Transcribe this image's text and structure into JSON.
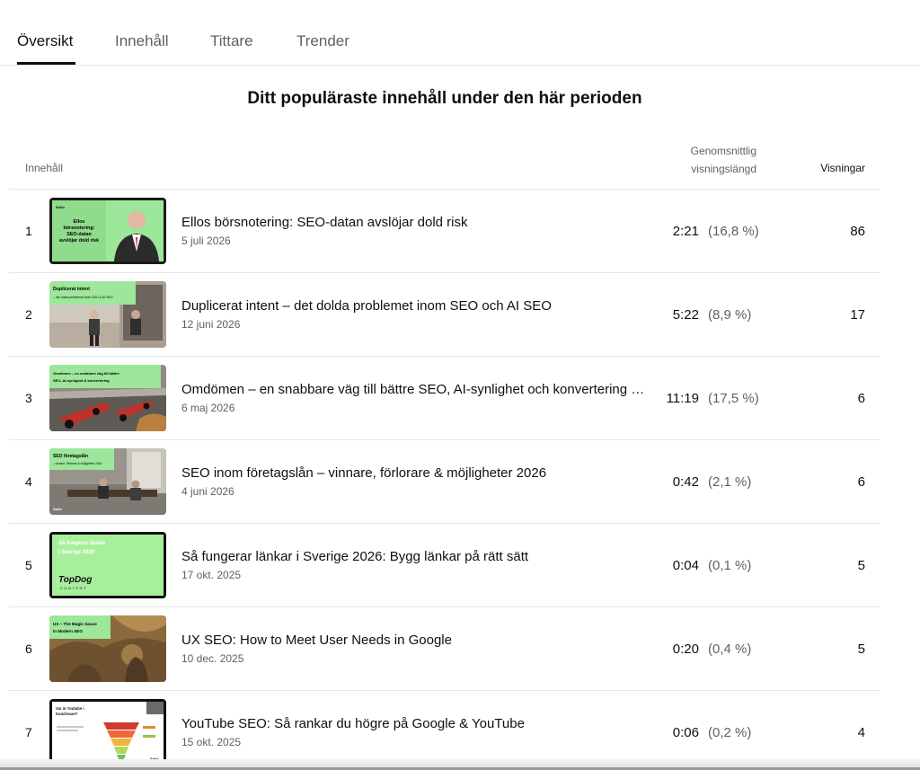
{
  "tabs": [
    {
      "label": "Översikt",
      "active": true
    },
    {
      "label": "Innehåll",
      "active": false
    },
    {
      "label": "Tittare",
      "active": false
    },
    {
      "label": "Trender",
      "active": false
    }
  ],
  "section": {
    "title": "Ditt populäraste innehåll under den här perioden"
  },
  "table": {
    "headers": {
      "content": "Innehåll",
      "avg_line1": "Genomsnittlig",
      "avg_line2": "visningslängd",
      "views": "Visningar"
    },
    "rows": [
      {
        "rank": "1",
        "title": "Ellos börsnotering: SEO-datan avslöjar dold risk",
        "date": "5 juli 2026",
        "duration": "2:21",
        "percent": "(16,8 %)",
        "views": "86",
        "thumb_text": [
          "Ellos",
          "börsnotering:",
          "SEO-datan",
          "avslöjar dold risk"
        ]
      },
      {
        "rank": "2",
        "title": "Duplicerat intent – det dolda problemet inom SEO och AI SEO",
        "date": "12 juni 2026",
        "duration": "5:22",
        "percent": "(8,9 %)",
        "views": "17",
        "thumb_text": [
          "Duplicerat intent",
          "– det dolda problemet inom SEO & AI SEO"
        ]
      },
      {
        "rank": "3",
        "title": "Omdömen – en snabbare väg till bättre SEO, AI-synlighet och konvertering …",
        "date": "6 maj 2026",
        "duration": "11:19",
        "percent": "(17,5 %)",
        "views": "6",
        "thumb_text": [
          "Omdömen – en snabbare väg till bättre",
          "SEO, AI-synlighet & konvertering"
        ]
      },
      {
        "rank": "4",
        "title": "SEO inom företagslån – vinnare, förlorare & möjligheter 2026",
        "date": "4 juni 2026",
        "duration": "0:42",
        "percent": "(2,1 %)",
        "views": "6",
        "thumb_text": [
          "SEO företagslån",
          "– vinnare, förlorare & möjligheter 2026"
        ]
      },
      {
        "rank": "5",
        "title": "Så fungerar länkar i Sverige 2026: Bygg länkar på rätt sätt",
        "date": "17 okt. 2025",
        "duration": "0:04",
        "percent": "(0,1 %)",
        "views": "5",
        "thumb_text": [
          "Så fungerar länkar",
          "i Sverige 2026",
          "TopDog",
          "CONTENT"
        ]
      },
      {
        "rank": "6",
        "title": "UX SEO: How to Meet User Needs in Google",
        "date": "10 dec. 2025",
        "duration": "0:20",
        "percent": "(0,4 %)",
        "views": "5",
        "thumb_text": [
          "UX – The Magic Sauce",
          "in Modern SEO"
        ]
      },
      {
        "rank": "7",
        "title": "YouTube SEO: Så rankar du högre på Google & YouTube",
        "date": "15 okt. 2025",
        "duration": "0:06",
        "percent": "(0,2 %)",
        "views": "4",
        "thumb_text": [
          "Var är Youtube i",
          "Kundresan?"
        ]
      }
    ]
  },
  "colors": {
    "brand_green": "#9ce79a",
    "text_primary": "#0f0f0f",
    "text_secondary": "#606060",
    "divider": "#e5e5e5"
  }
}
